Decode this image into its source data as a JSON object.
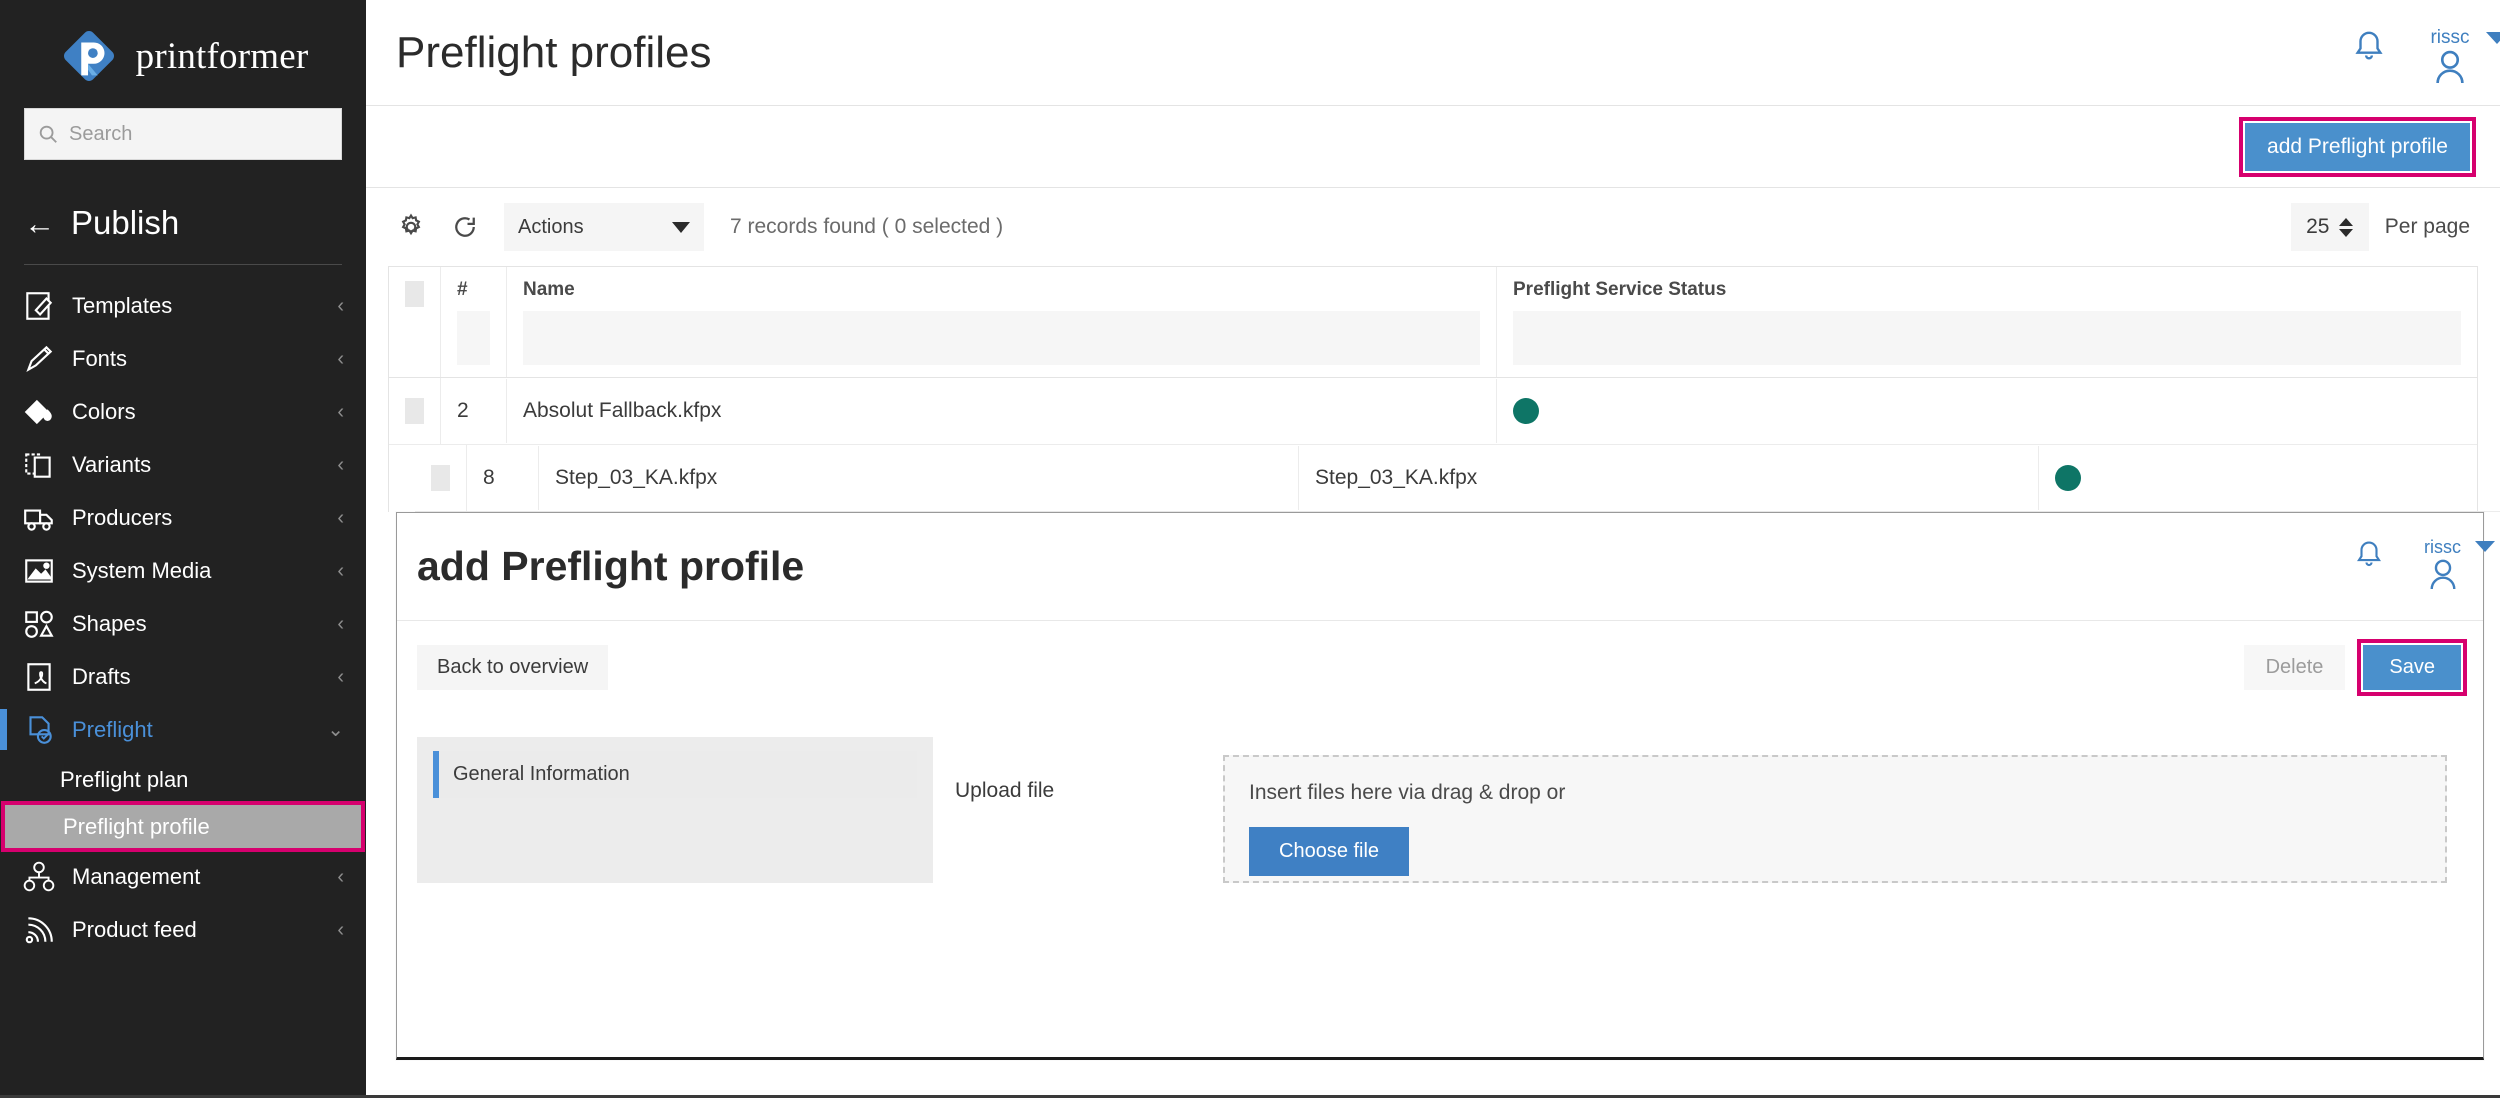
{
  "sidebar": {
    "brand": {
      "name": "printformer",
      "logo_icon": "printformer-logo-icon"
    },
    "search": {
      "placeholder": "Search",
      "value": "",
      "icon": "search-icon"
    },
    "publish": {
      "label": "Publish",
      "back_arrow": "←"
    },
    "items": [
      {
        "label": "Templates",
        "icon": "template-edit-icon",
        "chevron": "‹"
      },
      {
        "label": "Fonts",
        "icon": "pencil-icon",
        "chevron": "‹"
      },
      {
        "label": "Colors",
        "icon": "paint-bucket-icon",
        "chevron": "‹"
      },
      {
        "label": "Variants",
        "icon": "copy-pages-icon",
        "chevron": "‹"
      },
      {
        "label": "Producers",
        "icon": "truck-icon",
        "chevron": "‹"
      },
      {
        "label": "System Media",
        "icon": "image-icon",
        "chevron": "‹"
      },
      {
        "label": "Shapes",
        "icon": "shapes-icon",
        "chevron": "‹"
      },
      {
        "label": "Drafts",
        "icon": "pdf-document-icon",
        "chevron": "‹"
      },
      {
        "label": "Preflight",
        "icon": "preflight-check-icon",
        "chevron": "⌄",
        "active": true
      }
    ],
    "preflight_children": [
      {
        "label": "Preflight plan",
        "selected": false
      },
      {
        "label": "Preflight profile",
        "selected": true
      }
    ],
    "items_after": [
      {
        "label": "Management",
        "icon": "org-chart-icon",
        "chevron": "‹"
      },
      {
        "label": "Product feed",
        "icon": "rss-feed-icon",
        "chevron": "‹"
      }
    ]
  },
  "header": {
    "title": "Preflight profiles",
    "bell_icon": "bell-icon",
    "user": {
      "name": "rissc",
      "avatar_icon": "user-avatar-icon",
      "caret_icon": "caret-down-icon"
    }
  },
  "actionbar": {
    "add_label": "add Preflight profile"
  },
  "toolbar": {
    "settings_icon": "gear-icon",
    "refresh_icon": "refresh-icon",
    "actions_select": {
      "value": "Actions",
      "caret_icon": "caret-down-icon"
    },
    "records_text": "7 records found ( 0 selected )",
    "per_page": {
      "value": "25",
      "label": "Per page",
      "stepper_icon": "spinner-updown-icon"
    }
  },
  "table": {
    "columns": [
      {
        "key": "checkbox",
        "label": ""
      },
      {
        "key": "num",
        "label": "#"
      },
      {
        "key": "name",
        "label": "Name"
      },
      {
        "key": "status",
        "label": "Preflight Service Status"
      }
    ],
    "filter_row": {
      "num": "",
      "name": "",
      "status": ""
    },
    "rows": [
      {
        "num": "2",
        "name": "Absolut Fallback.kfpx",
        "name2": "",
        "status_color": "#0e7566"
      },
      {
        "num": "8",
        "name": "Step_03_KA.kfpx",
        "name2": "Step_03_KA.kfpx",
        "status_color": "#0e7566"
      }
    ]
  },
  "modal": {
    "title": "add Preflight profile",
    "bell_icon": "bell-icon",
    "user": {
      "name": "rissc",
      "avatar_icon": "user-avatar-icon",
      "caret_icon": "caret-down-icon"
    },
    "back_label": "Back to overview",
    "delete_label": "Delete",
    "save_label": "Save",
    "general_information_label": "General Information",
    "upload_file_label": "Upload file",
    "dropzone_text": "Insert files here via drag & drop or",
    "choose_file_label": "Choose file"
  },
  "colors": {
    "brand_blue": "#4a90cc",
    "highlight_pink": "#d6006e",
    "status_green": "#0e7566",
    "sidebar_bg": "#222222"
  }
}
